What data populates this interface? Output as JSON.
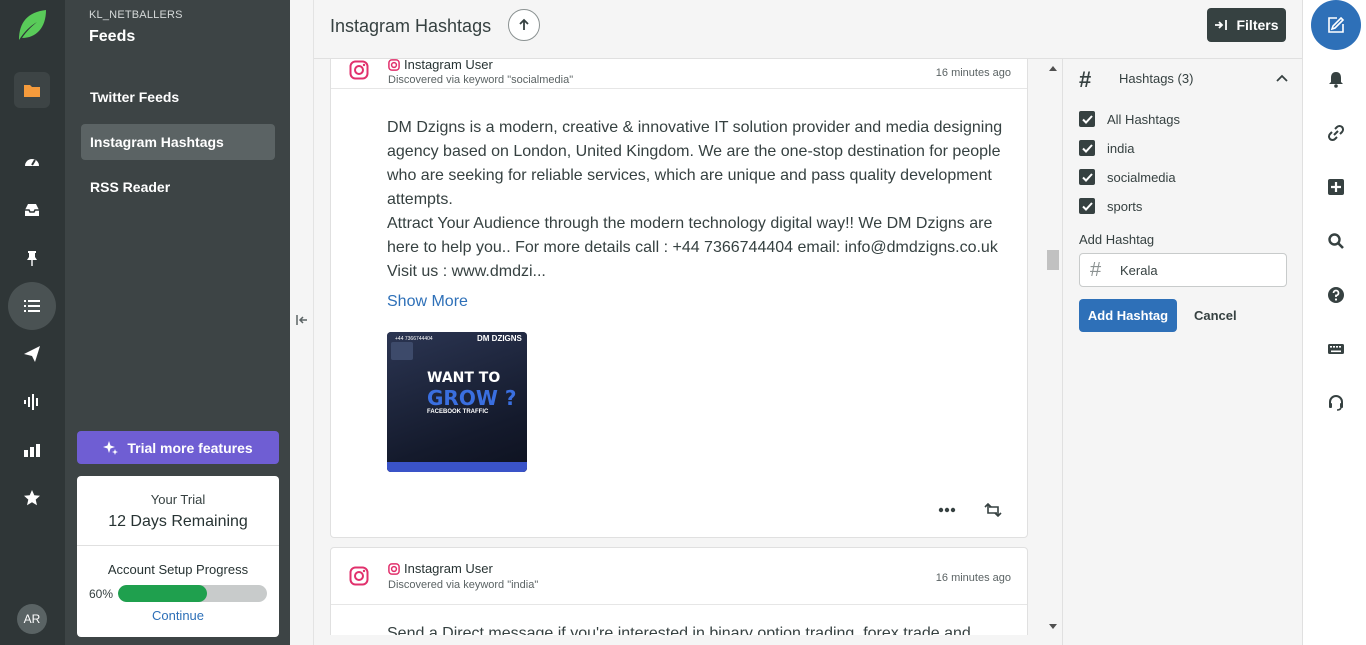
{
  "org": "KL_NETBALLERS",
  "section_title": "Feeds",
  "nav": [
    {
      "label": "Twitter Feeds"
    },
    {
      "label": "Instagram Hashtags"
    },
    {
      "label": "RSS Reader"
    }
  ],
  "trial": {
    "button": "Trial more features",
    "your_trial": "Your Trial",
    "remaining": "12 Days Remaining",
    "setup_label": "Account Setup Progress",
    "progress_pct": "60%",
    "progress_value": 0.6,
    "continue": "Continue"
  },
  "avatar": "AR",
  "header": {
    "title": "Instagram Hashtags",
    "filters": "Filters"
  },
  "posts": [
    {
      "user": "Instagram User",
      "discovered": "Discovered via keyword \"socialmedia\"",
      "time": "16 minutes ago",
      "paragraph1": "DM Dzigns is a modern, creative & innovative IT solution provider and media designing agency based on London, United Kingdom. We are the one-stop destination for people who are seeking for reliable services, which are unique and pass quality development attempts.",
      "paragraph2": "Attract Your Audience through the modern technology digital way!! We DM Dzigns are here to help you.. For more details call : +44 7366744404 email: info@dmdzigns.co.uk Visit us : www.dmdzi...",
      "show_more": "Show More",
      "image_text": {
        "brand": "DM DZIGNS",
        "line1": "WANT TO",
        "line2": "GROW ?",
        "line3": "FACEBOOK TRAFFIC",
        "phone": "+44 7366744404"
      }
    },
    {
      "user": "Instagram User",
      "discovered": "Discovered via keyword \"india\"",
      "time": "16 minutes ago",
      "paragraph1": "Send a Direct message if you're interested in binary option trading, forex trade and"
    }
  ],
  "filters": {
    "header": "Hashtags (3)",
    "options": [
      {
        "label": "All Hashtags",
        "checked": true
      },
      {
        "label": "india",
        "checked": true
      },
      {
        "label": "socialmedia",
        "checked": true
      },
      {
        "label": "sports",
        "checked": true
      }
    ],
    "add_label": "Add Hashtag",
    "input_value": "Kerala",
    "add_button": "Add Hashtag",
    "cancel": "Cancel"
  },
  "colors": {
    "primary": "#2e70b8",
    "trial": "#6f5ed3",
    "progress": "#1fa04e",
    "instagram": "#e1306c",
    "logo": "#59cb59"
  }
}
